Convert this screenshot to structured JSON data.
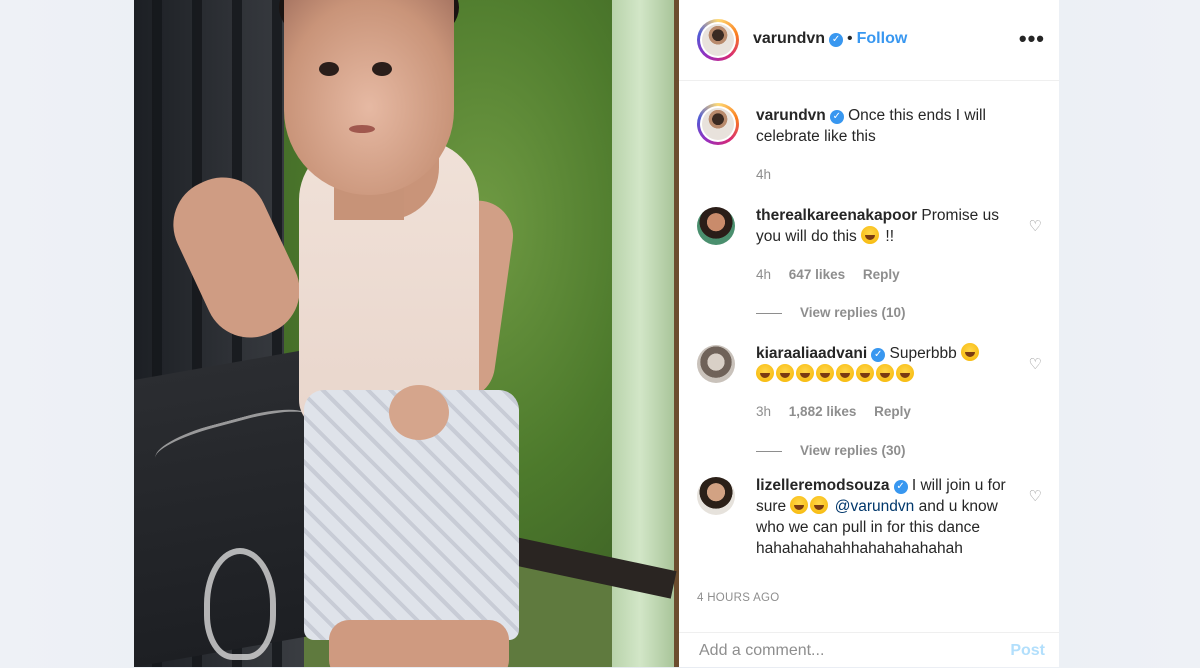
{
  "post": {
    "username": "varundvn",
    "follow_label": "Follow",
    "dot": "•",
    "more_label": "•••"
  },
  "caption": {
    "username": "varundvn",
    "text": "Once this ends I will celebrate like this",
    "time": "4h"
  },
  "comments": [
    {
      "username": "therealkareenakapoor",
      "text": "Promise us you will do this",
      "suffix": " !!",
      "time": "4h",
      "likes": "647 likes",
      "reply": "Reply",
      "view_replies": "View replies (10)"
    },
    {
      "username": "kiaraaliaadvani",
      "text": "Superbbb",
      "time": "3h",
      "likes": "1,882 likes",
      "reply": "Reply",
      "view_replies": "View replies (30)"
    },
    {
      "username": "lizelleremodsouza",
      "text_before": "I will join u for sure",
      "mention": "@varundvn",
      "text_after": " and u know who we can pull in for this dance hahahahahahhahahahahahah"
    }
  ],
  "time_ago": "4 HOURS AGO",
  "add_comment": {
    "placeholder": "Add a comment...",
    "post_label": "Post"
  },
  "icons": {
    "verified": "verified-badge-icon",
    "heart": "heart-icon",
    "more": "more-options-icon"
  },
  "colors": {
    "accent": "#3897f0",
    "muted": "#8e8e8e",
    "post_disabled": "#b2dffc"
  }
}
